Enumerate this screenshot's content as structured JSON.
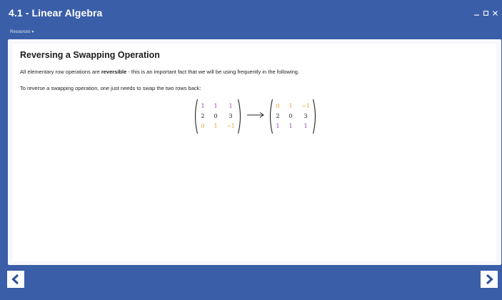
{
  "window": {
    "title": "4.1 - Linear Algebra",
    "controls": [
      "minimize",
      "maximize",
      "close"
    ]
  },
  "menu": {
    "resources_label": "Resources ▾"
  },
  "content": {
    "heading": "Reversing a Swapping Operation",
    "para1_before": "All elementary row operations are ",
    "para1_bold": "reversible",
    "para1_after": " - this is an important fact that we will be using frequently in the following.",
    "para2": "To reverse a swapping operation, one just needs to swap the two rows back:",
    "matrix_left": [
      [
        "1",
        "1",
        "1"
      ],
      [
        "2",
        "0",
        "3"
      ],
      [
        "0",
        "1",
        "−1"
      ]
    ],
    "matrix_right": [
      [
        "0",
        "1",
        "−1"
      ],
      [
        "2",
        "0",
        "3"
      ],
      [
        "1",
        "1",
        "1"
      ]
    ],
    "row_colors_left": [
      "purple",
      "dark",
      "orange"
    ],
    "row_colors_right": [
      "orange",
      "dark",
      "purple"
    ],
    "colors": {
      "purple": "#9b3bb8",
      "orange": "#e8a22a",
      "background": "#3a5ea8"
    }
  },
  "nav": {
    "prev_icon": "chevron-left-icon",
    "next_icon": "chevron-right-icon"
  }
}
